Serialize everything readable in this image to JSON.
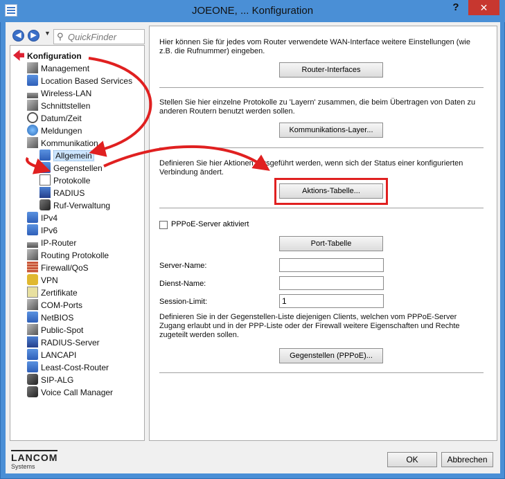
{
  "window": {
    "title": "JOEONE, ... Konfiguration",
    "help_label": "?",
    "close_label": "✕"
  },
  "sidebar": {
    "back_icon": "back-arrow-icon",
    "forward_icon": "forward-arrow-icon",
    "quickfinder_placeholder": "QuickFinder",
    "tree": [
      {
        "label": "Konfiguration",
        "icon": "config-root-icon"
      },
      {
        "label": "Management",
        "icon": "management-icon"
      },
      {
        "label": "Location Based Services",
        "icon": "location-icon"
      },
      {
        "label": "Wireless-LAN",
        "icon": "wlan-icon"
      },
      {
        "label": "Schnittstellen",
        "icon": "interfaces-icon"
      },
      {
        "label": "Datum/Zeit",
        "icon": "clock-icon"
      },
      {
        "label": "Meldungen",
        "icon": "info-icon"
      },
      {
        "label": "Kommunikation",
        "icon": "communication-icon"
      },
      {
        "label": "Allgemein",
        "icon": "network-icon"
      },
      {
        "label": "Gegenstellen",
        "icon": "network-icon"
      },
      {
        "label": "Protokolle",
        "icon": "document-icon"
      },
      {
        "label": "RADIUS",
        "icon": "server-icon"
      },
      {
        "label": "Ruf-Verwaltung",
        "icon": "call-icon"
      },
      {
        "label": "IPv4",
        "icon": "network-icon"
      },
      {
        "label": "IPv6",
        "icon": "network-icon"
      },
      {
        "label": "IP-Router",
        "icon": "router-icon"
      },
      {
        "label": "Routing Protokolle",
        "icon": "routing-icon"
      },
      {
        "label": "Firewall/QoS",
        "icon": "firewall-icon"
      },
      {
        "label": "VPN",
        "icon": "lock-icon"
      },
      {
        "label": "Zertifikate",
        "icon": "certificate-icon"
      },
      {
        "label": "COM-Ports",
        "icon": "port-icon"
      },
      {
        "label": "NetBIOS",
        "icon": "network-icon"
      },
      {
        "label": "Public-Spot",
        "icon": "hotspot-icon"
      },
      {
        "label": "RADIUS-Server",
        "icon": "server-icon"
      },
      {
        "label": "LANCAPI",
        "icon": "network-icon"
      },
      {
        "label": "Least-Cost-Router",
        "icon": "network-icon"
      },
      {
        "label": "SIP-ALG",
        "icon": "phone-icon"
      },
      {
        "label": "Voice Call Manager",
        "icon": "phone-icon"
      }
    ]
  },
  "content": {
    "section1_text": "Hier können Sie für jedes vom Router verwendete WAN-Interface weitere Einstellungen (wie z.B. die Rufnummer) eingeben.",
    "router_interfaces_label": "Router-Interfaces",
    "section2_text": "Stellen Sie hier einzelne Protokolle zu 'Layern' zusammen, die beim Übertragen von Daten zu anderen Routern benutzt werden sollen.",
    "comm_layer_label": "Kommunikations-Layer...",
    "section3_text": "Definieren Sie hier Aktionen, ausgeführt werden, wenn sich der Status einer konfigurierten Verbindung ändert.",
    "action_table_label": "Aktions-Tabelle...",
    "pppoe_checkbox_label": "PPPoE-Server aktiviert",
    "port_table_label": "Port-Tabelle",
    "server_name_label": "Server-Name:",
    "server_name_value": "",
    "service_name_label": "Dienst-Name:",
    "service_name_value": "",
    "session_limit_label": "Session-Limit:",
    "session_limit_value": "1",
    "section4_text": "Definieren Sie in der Gegenstellen-Liste diejenigen Clients, welchen vom PPPoE-Server Zugang erlaubt und in der PPP-Liste oder der Firewall weitere Eigenschaften und Rechte zugeteilt werden sollen.",
    "remote_sites_label": "Gegenstellen (PPPoE)..."
  },
  "footer": {
    "logo": "LANCOM",
    "logo_sub": "Systems",
    "ok_label": "OK",
    "cancel_label": "Abbrechen"
  },
  "colors": {
    "titlebar": "#4a8fd6",
    "close": "#c7372f",
    "annotation": "#e02020"
  }
}
